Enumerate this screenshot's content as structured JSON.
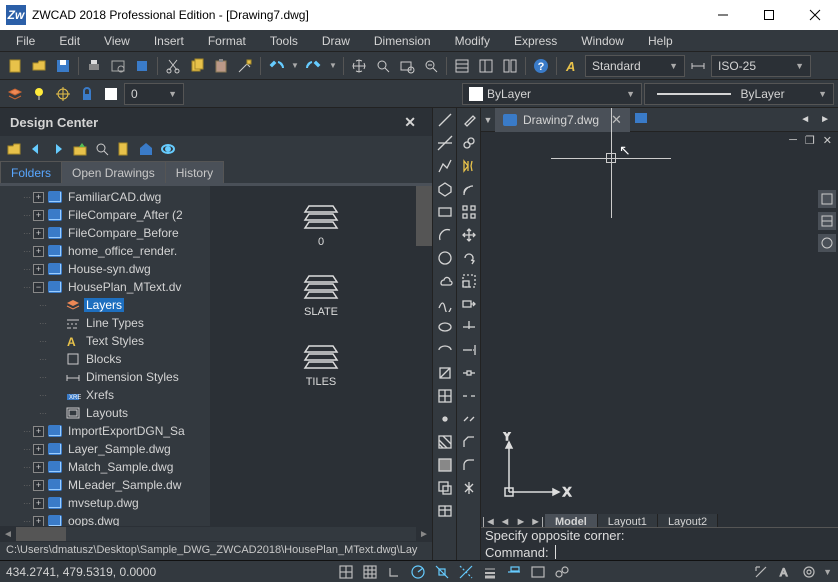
{
  "titlebar": {
    "app_icon_text": "Zw",
    "title": "ZWCAD 2018 Professional Edition - [Drawing7.dwg]"
  },
  "menu": {
    "items": [
      "File",
      "Edit",
      "View",
      "Insert",
      "Format",
      "Tools",
      "Draw",
      "Dimension",
      "Modify",
      "Express",
      "Window",
      "Help"
    ]
  },
  "toolbar1": {
    "style_label": "Standard",
    "dim_label": "ISO-25"
  },
  "toolbar2": {
    "layer_combo": "ByLayer",
    "linetype_combo": "ByLayer"
  },
  "design_center": {
    "title": "Design Center",
    "tabs": [
      "Folders",
      "Open Drawings",
      "History"
    ],
    "active_tab": 0,
    "tree": [
      {
        "depth": 1,
        "expand": "+",
        "icon": "dwg",
        "label": "FamiliarCAD.dwg"
      },
      {
        "depth": 1,
        "expand": "+",
        "icon": "dwg",
        "label": "FileCompare_After (2"
      },
      {
        "depth": 1,
        "expand": "+",
        "icon": "dwg",
        "label": "FileCompare_Before"
      },
      {
        "depth": 1,
        "expand": "+",
        "icon": "dwg",
        "label": "home_office_render."
      },
      {
        "depth": 1,
        "expand": "+",
        "icon": "dwg",
        "label": "House-syn.dwg"
      },
      {
        "depth": 1,
        "expand": "-",
        "icon": "dwg",
        "label": "HousePlan_MText.dv"
      },
      {
        "depth": 2,
        "expand": "",
        "icon": "layers",
        "label": "Layers",
        "selected": true
      },
      {
        "depth": 2,
        "expand": "",
        "icon": "ltype",
        "label": "Line Types"
      },
      {
        "depth": 2,
        "expand": "",
        "icon": "tstyle",
        "label": "Text Styles"
      },
      {
        "depth": 2,
        "expand": "",
        "icon": "blocks",
        "label": "Blocks"
      },
      {
        "depth": 2,
        "expand": "",
        "icon": "dimsty",
        "label": "Dimension Styles"
      },
      {
        "depth": 2,
        "expand": "",
        "icon": "xrefs",
        "label": "Xrefs"
      },
      {
        "depth": 2,
        "expand": "",
        "icon": "layout",
        "label": "Layouts"
      },
      {
        "depth": 1,
        "expand": "+",
        "icon": "dwg",
        "label": "ImportExportDGN_Sa"
      },
      {
        "depth": 1,
        "expand": "+",
        "icon": "dwg",
        "label": "Layer_Sample.dwg"
      },
      {
        "depth": 1,
        "expand": "+",
        "icon": "dwg",
        "label": "Match_Sample.dwg"
      },
      {
        "depth": 1,
        "expand": "+",
        "icon": "dwg",
        "label": "MLeader_Sample.dw"
      },
      {
        "depth": 1,
        "expand": "+",
        "icon": "dwg",
        "label": "mvsetup.dwg"
      },
      {
        "depth": 1,
        "expand": "+",
        "icon": "dwg",
        "label": "oops.dwg"
      }
    ],
    "preview_items": [
      {
        "name": "0"
      },
      {
        "name": "SLATE"
      },
      {
        "name": "TILES"
      }
    ],
    "path": "C:\\Users\\dmatusz\\Desktop\\Sample_DWG_ZWCAD2018\\HousePlan_MText.dwg\\Lay"
  },
  "doc_tab": {
    "label": "Drawing7.dwg"
  },
  "layout_tabs": {
    "items": [
      "Model",
      "Layout1",
      "Layout2"
    ],
    "active": 0
  },
  "ucs": {
    "x": "X",
    "y": "Y"
  },
  "command": {
    "history": "Specify opposite corner:",
    "prompt": "Command:"
  },
  "status": {
    "coords": "434.2741, 479.5319, 0.0000"
  }
}
